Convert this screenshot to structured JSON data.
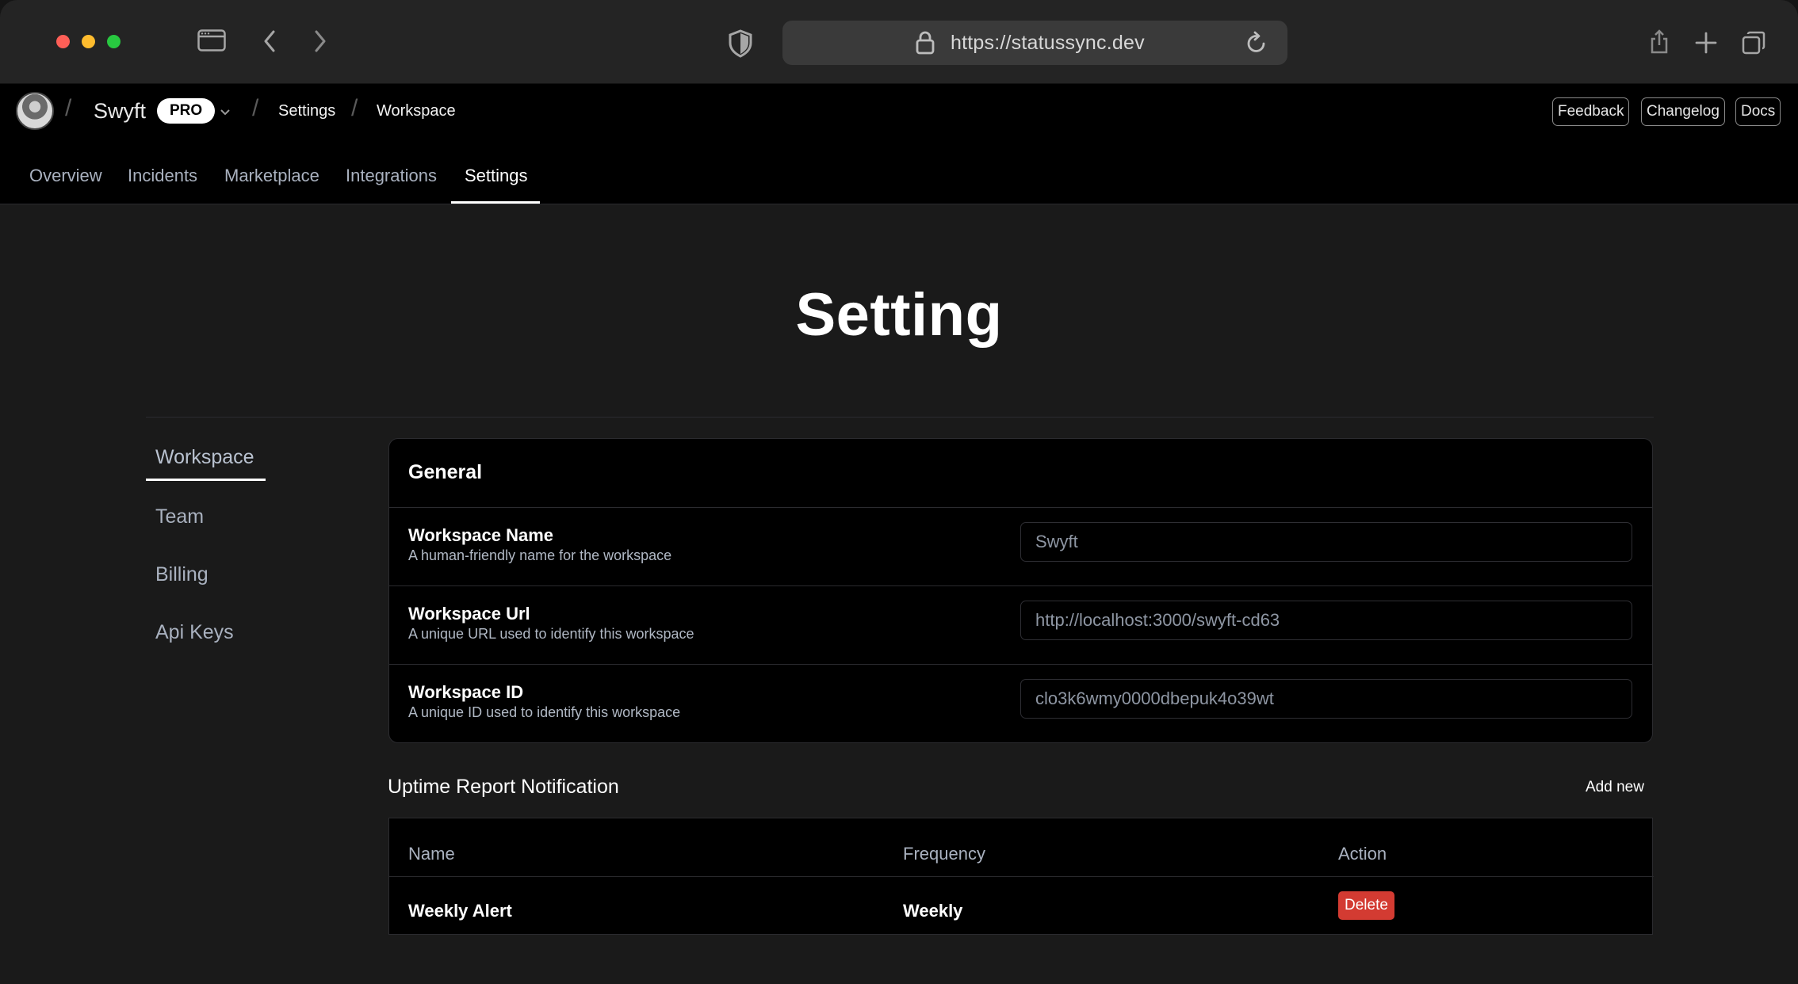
{
  "browser": {
    "url": "https://statussync.dev"
  },
  "header": {
    "workspace_name": "Swyft",
    "plan_badge": "PRO",
    "breadcrumbs": [
      "Settings",
      "Workspace"
    ],
    "buttons": {
      "feedback": "Feedback",
      "changelog": "Changelog",
      "docs": "Docs"
    }
  },
  "tabs": [
    {
      "label": "Overview"
    },
    {
      "label": "Incidents"
    },
    {
      "label": "Marketplace"
    },
    {
      "label": "Integrations"
    },
    {
      "label": "Settings",
      "active": true
    }
  ],
  "page": {
    "title": "Setting"
  },
  "sidenav": {
    "items": [
      {
        "label": "Workspace",
        "active": true
      },
      {
        "label": "Team"
      },
      {
        "label": "Billing"
      },
      {
        "label": "Api Keys"
      }
    ]
  },
  "general": {
    "title": "General",
    "rows": [
      {
        "label": "Workspace Name",
        "description": "A human-friendly name for the workspace",
        "value": "Swyft"
      },
      {
        "label": "Workspace Url",
        "description": "A unique URL used to identify this workspace",
        "value": "http://localhost:3000/swyft-cd63"
      },
      {
        "label": "Workspace ID",
        "description": "A unique ID used to identify this workspace",
        "value": "clo3k6wmy0000dbepuk4o39wt"
      }
    ]
  },
  "notifications": {
    "title": "Uptime Report Notification",
    "add_new_label": "Add new",
    "columns": [
      "Name",
      "Frequency",
      "Action"
    ],
    "rows": [
      {
        "name": "Weekly Alert",
        "frequency": "Weekly",
        "action_label": "Delete"
      }
    ]
  },
  "colors": {
    "delete": "#d33b32",
    "background": "#1a1a1a",
    "card": "#000000"
  }
}
